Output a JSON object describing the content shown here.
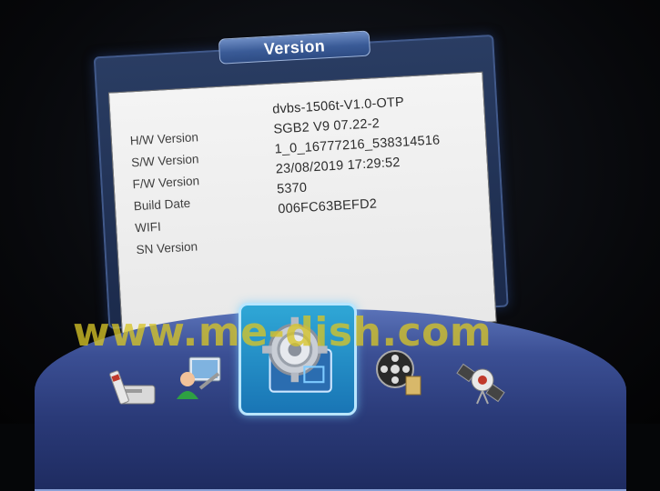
{
  "dialog": {
    "title": "Version",
    "rows": [
      {
        "label": "H/W Version",
        "value": "dvbs-1506t-V1.0-OTP"
      },
      {
        "label": "S/W Version",
        "value": "SGB2 V9 07.22-2"
      },
      {
        "label": "F/W Version",
        "value": "1_0_16777216_538314516"
      },
      {
        "label": "Build Date",
        "value": "23/08/2019 17:29:52"
      },
      {
        "label": "WIFI",
        "value": "5370"
      },
      {
        "label": "SN Version",
        "value": "006FC63BEFD2"
      }
    ]
  },
  "menu": {
    "items": [
      {
        "icon": "installation-icon"
      },
      {
        "icon": "user-tools-icon"
      },
      {
        "icon": "system-settings-icon",
        "selected": true
      },
      {
        "icon": "media-film-icon"
      },
      {
        "icon": "satellite-icon"
      }
    ]
  },
  "watermark": "www.me-dish.com"
}
